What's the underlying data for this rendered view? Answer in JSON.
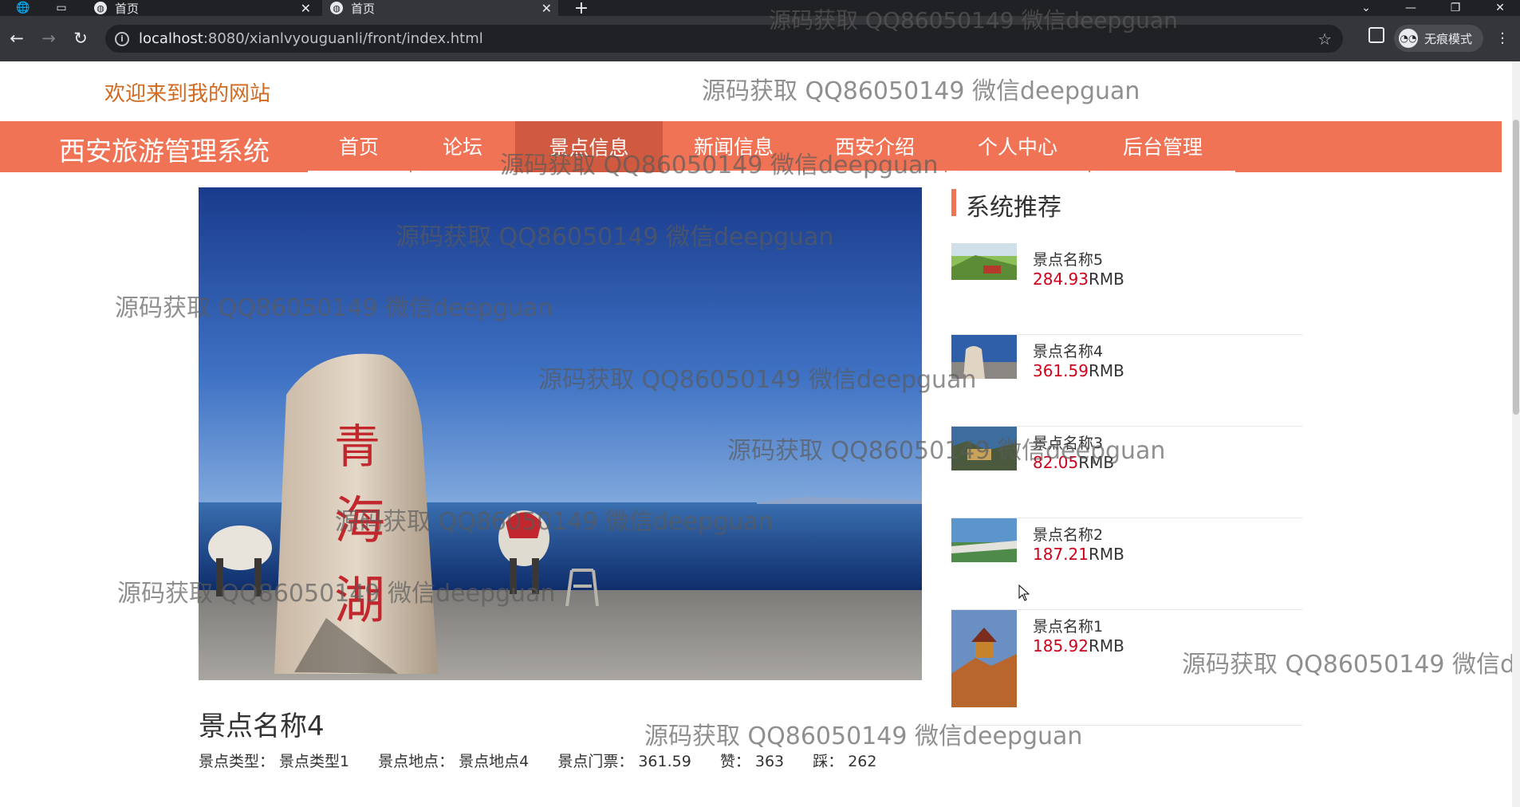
{
  "browser": {
    "tabs": [
      {
        "title": "首页"
      },
      {
        "title": "首页"
      }
    ],
    "url": {
      "host": "localhost",
      "path": ":8080/xianlvyouguanli/front/index.html"
    },
    "incognito_label": "无痕模式"
  },
  "site": {
    "welcome": "欢迎来到我的网站",
    "title": "西安旅游管理系统",
    "accent_color": "#f07356"
  },
  "nav": {
    "items": [
      "首页",
      "论坛",
      "景点信息",
      "新闻信息",
      "西安介绍",
      "个人中心",
      "后台管理"
    ],
    "active": "景点信息"
  },
  "detail": {
    "name": "景点名称4",
    "type_label": "景点类型：",
    "type_value": "景点类型1",
    "location_label": "景点地点：",
    "location_value": "景点地点4",
    "price_label": "景点门票：",
    "price_value": "361.59",
    "likes_label": "赞：",
    "likes_value": "363",
    "dislikes_label": "踩：",
    "dislikes_value": "262"
  },
  "recommend": {
    "heading": "系统推荐",
    "currency": "RMB",
    "items": [
      {
        "name": "景点名称5",
        "price": "284.93"
      },
      {
        "name": "景点名称4",
        "price": "361.59"
      },
      {
        "name": "景点名称3",
        "price": "82.05"
      },
      {
        "name": "景点名称2",
        "price": "187.21"
      },
      {
        "name": "景点名称1",
        "price": "185.92"
      }
    ]
  },
  "watermark": "源码获取 QQ86050149 微信deepguan"
}
